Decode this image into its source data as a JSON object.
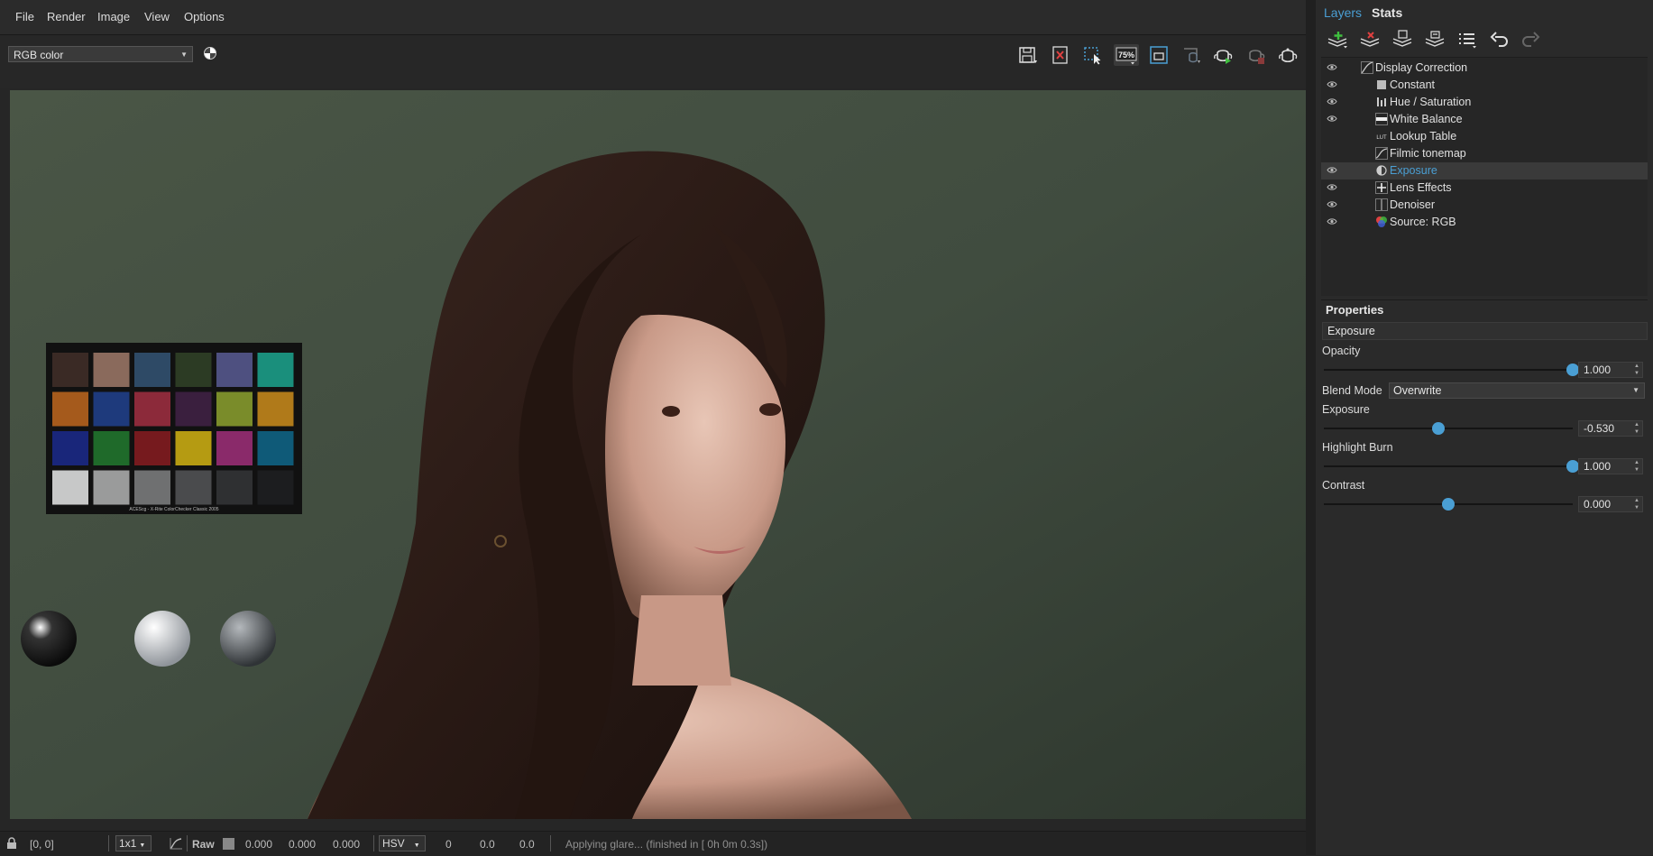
{
  "menu": [
    "File",
    "Render",
    "Image",
    "View",
    "Options"
  ],
  "toolbar": {
    "color_mode": "RGB color",
    "zoom_label": "75%"
  },
  "status": {
    "coords": "[0, 0]",
    "scale": "1x1",
    "raw_label": "Raw",
    "raw_values": [
      "0.000",
      "0.000",
      "0.000"
    ],
    "mode": "HSV",
    "hsv_values": [
      "0",
      "0.0",
      "0.0"
    ],
    "message": "Applying glare... (finished in [ 0h  0m  0.3s])"
  },
  "viewport": {
    "chart_caption": "ACEScg - X-Rite ColorChecker Classic 2005",
    "swatches": [
      "#3a2a25",
      "#8a6a5c",
      "#2e4a66",
      "#2c3b24",
      "#4e5080",
      "#1a8f7c",
      "#a55a1c",
      "#1e3a7c",
      "#8c2a3a",
      "#3a1f3e",
      "#7a8c2a",
      "#b07a1a",
      "#19267a",
      "#1f6a2a",
      "#761a1e",
      "#b59b12",
      "#8a2a6a",
      "#0f5a78",
      "#c7c8c8",
      "#9a9b9b",
      "#6f7071",
      "#4a4b4d",
      "#2f3032",
      "#1c1d1f"
    ]
  },
  "panel": {
    "tabs": [
      "Layers",
      "Stats"
    ],
    "active_tab": "Layers",
    "layers": [
      {
        "name": "Display Correction",
        "visible": true,
        "selected": false,
        "icon": "curve-icon"
      },
      {
        "name": "Constant",
        "visible": true,
        "selected": false,
        "icon": "square-icon"
      },
      {
        "name": "Hue / Saturation",
        "visible": true,
        "selected": false,
        "icon": "bars-icon"
      },
      {
        "name": "White Balance",
        "visible": true,
        "selected": false,
        "icon": "whitebalance-icon"
      },
      {
        "name": "Lookup Table",
        "visible": false,
        "selected": false,
        "icon": "lut-icon"
      },
      {
        "name": "Filmic tonemap",
        "visible": false,
        "selected": false,
        "icon": "tonemap-icon"
      },
      {
        "name": "Exposure",
        "visible": true,
        "selected": true,
        "icon": "exposure-icon"
      },
      {
        "name": "Lens Effects",
        "visible": true,
        "selected": false,
        "icon": "plus-icon"
      },
      {
        "name": "Denoiser",
        "visible": true,
        "selected": false,
        "icon": "denoiser-icon"
      },
      {
        "name": "Source: RGB",
        "visible": true,
        "selected": false,
        "icon": "source-icon"
      }
    ],
    "properties": {
      "title": "Properties",
      "layer_name": "Exposure",
      "opacity_label": "Opacity",
      "opacity_value": "1.000",
      "opacity_fraction": 1.0,
      "blend_label": "Blend Mode",
      "blend_value": "Overwrite",
      "exposure_label": "Exposure",
      "exposure_value": "-0.530",
      "exposure_fraction": 0.46,
      "highlight_label": "Highlight Burn",
      "highlight_value": "1.000",
      "highlight_fraction": 1.0,
      "contrast_label": "Contrast",
      "contrast_value": "0.000",
      "contrast_fraction": 0.5
    }
  },
  "colors": {
    "accent": "#4a9fd4",
    "background": "#262626"
  }
}
